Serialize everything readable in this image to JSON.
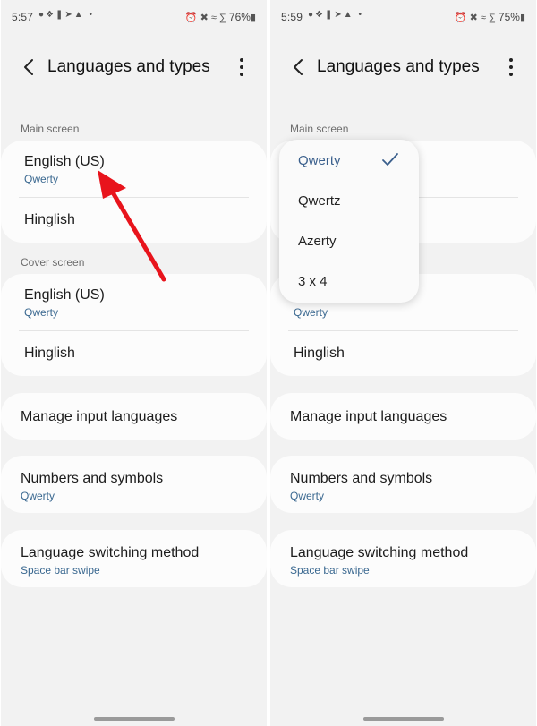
{
  "left": {
    "status": {
      "time": "5:57",
      "battery": "76%"
    },
    "header": {
      "title": "Languages and types"
    },
    "main_screen": {
      "label": "Main screen",
      "items": [
        {
          "primary": "English (US)",
          "secondary": "Qwerty"
        },
        {
          "primary": "Hinglish"
        }
      ]
    },
    "cover_screen": {
      "label": "Cover screen",
      "items": [
        {
          "primary": "English (US)",
          "secondary": "Qwerty"
        },
        {
          "primary": "Hinglish"
        }
      ]
    },
    "manage": {
      "primary": "Manage input languages"
    },
    "numbers": {
      "primary": "Numbers and symbols",
      "secondary": "Qwerty"
    },
    "switching": {
      "primary": "Language switching method",
      "secondary": "Space bar swipe"
    }
  },
  "right": {
    "status": {
      "time": "5:59",
      "battery": "75%"
    },
    "header": {
      "title": "Languages and types"
    },
    "main_screen": {
      "label": "Main screen"
    },
    "cover_screen": {
      "items": [
        {
          "secondary": "Qwerty"
        },
        {
          "primary": "Hinglish"
        }
      ]
    },
    "manage": {
      "primary": "Manage input languages"
    },
    "numbers": {
      "primary": "Numbers and symbols",
      "secondary": "Qwerty"
    },
    "switching": {
      "primary": "Language switching method",
      "secondary": "Space bar swipe"
    },
    "layout_popup": {
      "options": [
        "Qwerty",
        "Qwertz",
        "Azerty",
        "3 x 4"
      ],
      "selected": "Qwerty"
    }
  },
  "colors": {
    "accent": "#3a6890",
    "arrow": "#e8141c",
    "background": "#f2f2f2",
    "card": "#fcfcfc"
  },
  "icons": [
    "back-arrow-icon",
    "more-options-icon",
    "check-icon",
    "annotation-arrow-icon"
  ]
}
